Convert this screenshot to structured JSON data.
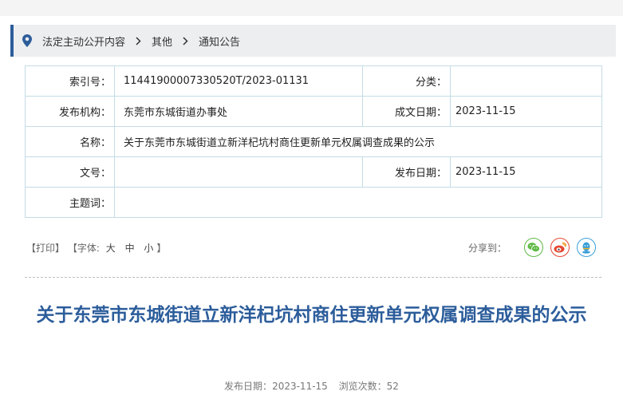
{
  "breadcrumb": {
    "items": [
      "法定主动公开内容",
      "其他",
      "通知公告"
    ]
  },
  "meta": {
    "index_label": "索引号：",
    "index_value": "11441900007330520T/2023-01131",
    "category_label": "分类：",
    "category_value": "",
    "publisher_label": "发布机构：",
    "publisher_value": "东莞市东城街道办事处",
    "created_label": "成文日期：",
    "created_value": "2023-11-15",
    "name_label": "名称：",
    "name_value": "关于东莞市东城街道立新洋杞坑村商住更新单元权属调查成果的公示",
    "docno_label": "文号：",
    "docno_value": "",
    "pubdate_label": "发布日期：",
    "pubdate_value": "2023-11-15",
    "subject_label": "主题词：",
    "subject_value": ""
  },
  "tools": {
    "print": "【打印】",
    "font_open": "【字体:",
    "font_large": "大",
    "font_medium": "中",
    "font_small": "小",
    "font_close": "】"
  },
  "share": {
    "label": "分享到：",
    "icons": [
      "wechat-icon",
      "weibo-icon",
      "qq-icon"
    ],
    "colors": {
      "wechat": "#5fb945",
      "weibo": "#e6452f",
      "qq": "#3a9fd8"
    }
  },
  "article": {
    "title": "关于东莞市东城街道立新洋杞坑村商住更新单元权属调查成果的公示",
    "pubdate_label": "发布日期：",
    "pubdate": "2023-11-15",
    "views_label": "浏览次数：",
    "views": "52"
  },
  "colors": {
    "accent": "#2c5d9b",
    "table_border": "#c4dce6"
  }
}
